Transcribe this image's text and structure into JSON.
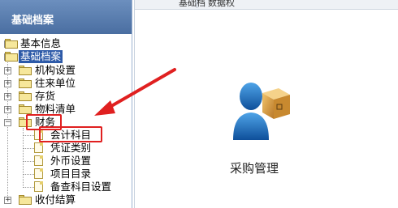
{
  "panel": {
    "title": "基础档案"
  },
  "topbar": {
    "fragment_left": "基础档",
    "fragment_right": "数据权"
  },
  "tree": {
    "items": [
      {
        "label": "基本信息"
      },
      {
        "label": "基础档案"
      },
      {
        "label": "机构设置"
      },
      {
        "label": "往来单位"
      },
      {
        "label": "存货"
      },
      {
        "label": "物料清单"
      },
      {
        "label": "财务"
      },
      {
        "label": "会计科目"
      },
      {
        "label": "凭证类别"
      },
      {
        "label": "外币设置"
      },
      {
        "label": "项目目录"
      },
      {
        "label": "备查科目设置"
      },
      {
        "label": "收付结算"
      }
    ]
  },
  "module": {
    "label": "采购管理"
  },
  "colors": {
    "accent": "#2d5aa8",
    "header": "#4a6ea1",
    "annotation": "#e02020"
  }
}
